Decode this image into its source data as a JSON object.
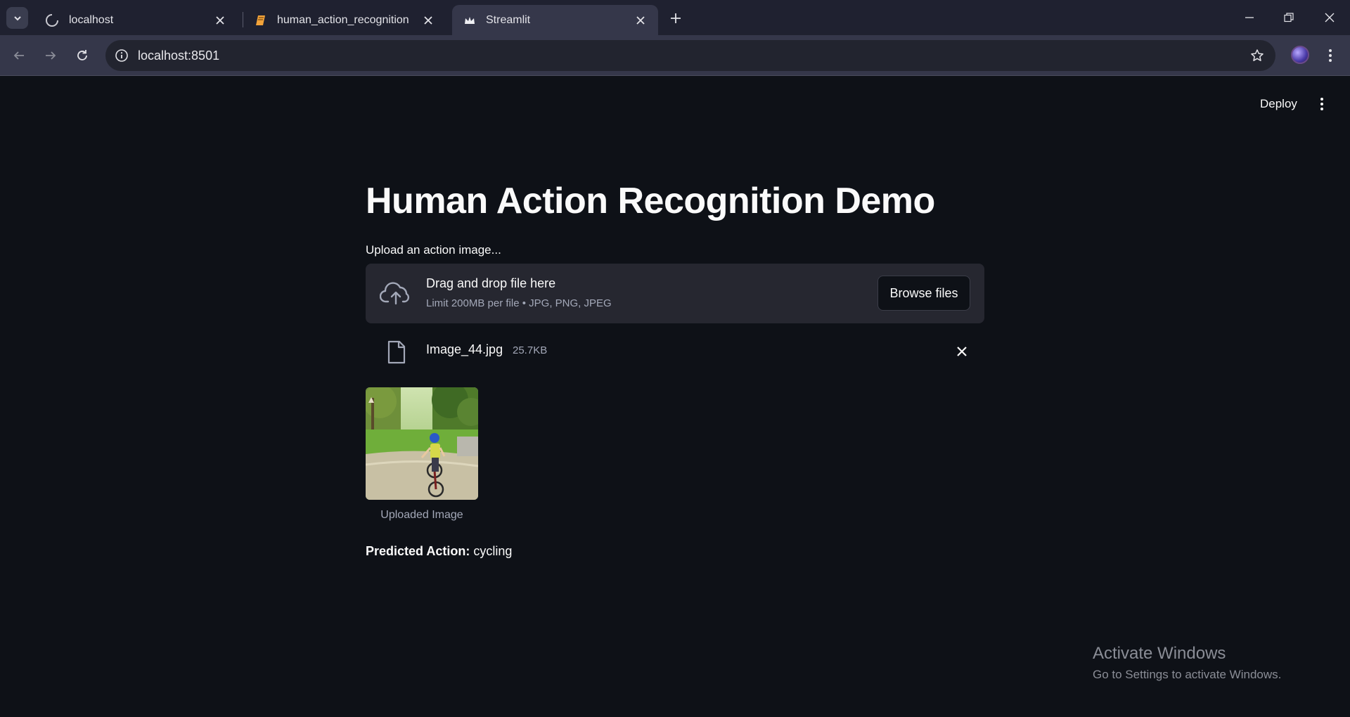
{
  "browser": {
    "tabs": [
      {
        "title": "localhost",
        "active": false,
        "icon": "loading-spinner-icon"
      },
      {
        "title": "human_action_recognition",
        "active": false,
        "icon": "notebook-icon"
      },
      {
        "title": "Streamlit",
        "active": true,
        "icon": "streamlit-crown-icon"
      }
    ],
    "url": "localhost:8501"
  },
  "app": {
    "deploy_label": "Deploy",
    "title": "Human Action Recognition Demo",
    "upload_label": "Upload an action image...",
    "dropzone": {
      "title": "Drag and drop file here",
      "limit": "Limit 200MB per file • JPG, PNG, JPEG",
      "browse_label": "Browse files"
    },
    "file": {
      "name": "Image_44.jpg",
      "size": "25.7KB"
    },
    "image_caption": "Uploaded Image",
    "prediction": {
      "label": "Predicted Action:",
      "value": "cycling"
    }
  },
  "os": {
    "activate_title": "Activate Windows",
    "activate_sub": "Go to Settings to activate Windows."
  },
  "colors": {
    "background": "#0e1117",
    "dropzone": "#262730",
    "text": "#fafafa",
    "muted": "#a3a8b8"
  }
}
